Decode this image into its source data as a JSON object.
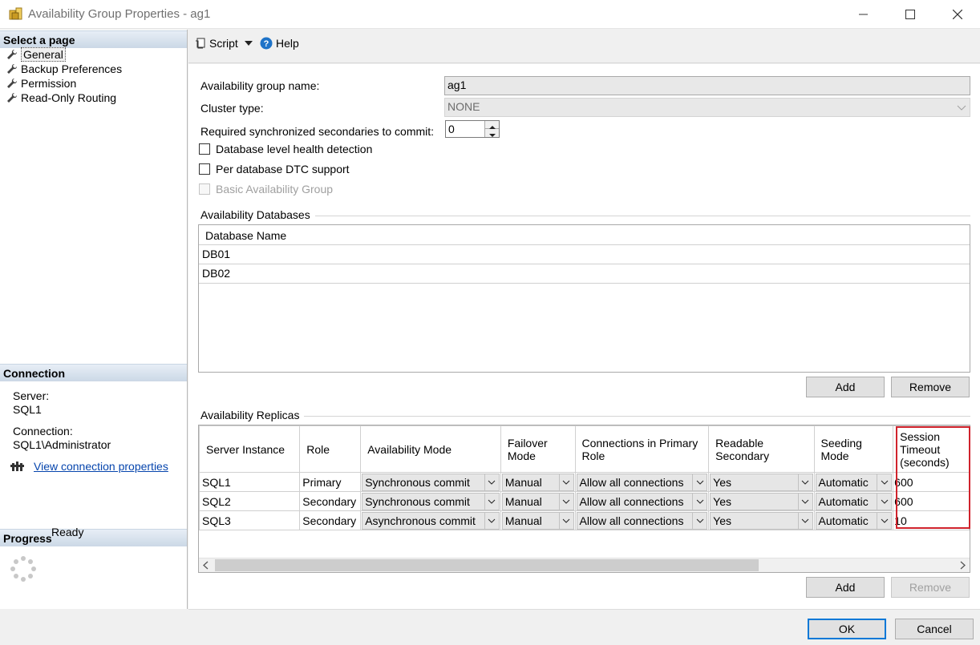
{
  "window": {
    "title": "Availability Group Properties - ag1"
  },
  "left": {
    "select_page_header": "Select a page",
    "pages": [
      {
        "label": "General"
      },
      {
        "label": "Backup Preferences"
      },
      {
        "label": "Permission"
      },
      {
        "label": "Read-Only Routing"
      }
    ],
    "connection_header": "Connection",
    "server_label": "Server:",
    "server_value": "SQL1",
    "connection_label": "Connection:",
    "connection_value": "SQL1\\Administrator",
    "view_connection_link": "View connection properties",
    "progress_header": "Progress",
    "progress_status": "Ready"
  },
  "toolbar": {
    "script_label": "Script",
    "help_label": "Help"
  },
  "general": {
    "ag_name_label": "Availability group name:",
    "ag_name_value": "ag1",
    "cluster_type_label": "Cluster type:",
    "cluster_type_value": "NONE",
    "required_sync_label": "Required synchronized secondaries to commit:",
    "required_sync_value": "0",
    "db_health_label": "Database level health detection",
    "dtc_label": "Per database DTC support",
    "basic_ag_label": "Basic Availability Group"
  },
  "databases": {
    "group_title": "Availability Databases",
    "column_header": "Database Name",
    "rows": [
      "DB01",
      "DB02"
    ],
    "add_label": "Add",
    "remove_label": "Remove"
  },
  "replicas": {
    "group_title": "Availability Replicas",
    "headers": {
      "server": "Server Instance",
      "role": "Role",
      "availability_mode": "Availability Mode",
      "failover_mode": "Failover Mode",
      "connections_primary": "Connections in Primary Role",
      "readable_secondary": "Readable Secondary",
      "seeding_mode": "Seeding Mode",
      "session_timeout": "Session Timeout (seconds)"
    },
    "rows": [
      {
        "server": "SQL1",
        "role": "Primary",
        "availability_mode": "Synchronous commit",
        "failover_mode": "Manual",
        "connections_primary": "Allow all connections",
        "readable_secondary": "Yes",
        "seeding_mode": "Automatic",
        "session_timeout": "600"
      },
      {
        "server": "SQL2",
        "role": "Secondary",
        "availability_mode": "Synchronous commit",
        "failover_mode": "Manual",
        "connections_primary": "Allow all connections",
        "readable_secondary": "Yes",
        "seeding_mode": "Automatic",
        "session_timeout": "600"
      },
      {
        "server": "SQL3",
        "role": "Secondary",
        "availability_mode": "Asynchronous commit",
        "failover_mode": "Manual",
        "connections_primary": "Allow all connections",
        "readable_secondary": "Yes",
        "seeding_mode": "Automatic",
        "session_timeout": "10"
      }
    ],
    "add_label": "Add",
    "remove_label": "Remove"
  },
  "footer": {
    "ok_label": "OK",
    "cancel_label": "Cancel"
  },
  "colors": {
    "highlight_border": "#d0232c",
    "link": "#0645ad",
    "ok_focus": "#0078d7"
  }
}
